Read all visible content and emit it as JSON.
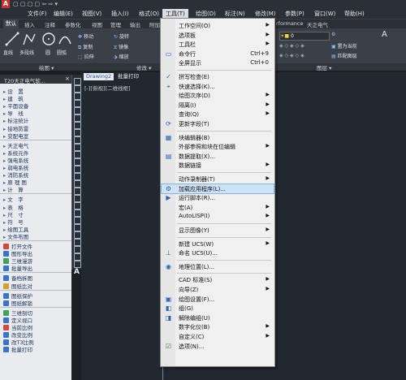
{
  "menubar": {
    "items": [
      "文件(F)",
      "编辑(E)",
      "视图(V)",
      "插入(I)",
      "格式(O)",
      "工具(T)",
      "绘图(D)",
      "标注(N)",
      "修改(M)",
      "参数(P)",
      "窗口(W)",
      "帮助(H)"
    ]
  },
  "ribbon": {
    "tabs": [
      "默认",
      "插入",
      "注释",
      "参数化",
      "视图",
      "管理",
      "输出",
      "附加"
    ],
    "right_tabs": [
      "rformance",
      "天正电气"
    ],
    "tools": {
      "line": "直线",
      "polyline": "多段线",
      "circle": "圆",
      "arc": "圆弧",
      "move": "移动",
      "rotate": "旋转",
      "copy": "复制",
      "mirror": "镜像",
      "stretch": "拉伸",
      "scale": "缩放",
      "set_current": "置为当前",
      "match_layer": "匹配图层",
      "layer_value": "0"
    },
    "panels": [
      "绘图 ▾",
      "修改 ▾",
      "图层 ▾"
    ]
  },
  "palette": {
    "title": "T20天正电气软...",
    "items": [
      {
        "type": "tri",
        "label": "设　置"
      },
      {
        "type": "tri",
        "label": "建　筑"
      },
      {
        "type": "tri",
        "label": "平面设备"
      },
      {
        "type": "tri",
        "label": "导　线"
      },
      {
        "type": "tri",
        "label": "标注统计"
      },
      {
        "type": "tri",
        "label": "接地防雷"
      },
      {
        "type": "tri",
        "label": "变配电室"
      },
      {
        "type": "sep"
      },
      {
        "type": "tri",
        "label": "天正电气"
      },
      {
        "type": "tri",
        "label": "系统元件"
      },
      {
        "type": "tri",
        "label": "强电系统"
      },
      {
        "type": "tri",
        "label": "弱电系统"
      },
      {
        "type": "tri",
        "label": "消防系统"
      },
      {
        "type": "tri",
        "label": "原 理 图"
      },
      {
        "type": "tri",
        "label": "计　算"
      },
      {
        "type": "sep"
      },
      {
        "type": "tri",
        "label": "文　字"
      },
      {
        "type": "tri",
        "label": "表　格"
      },
      {
        "type": "tri",
        "label": "尺　寸"
      },
      {
        "type": "tri",
        "label": "符　号"
      },
      {
        "type": "tri",
        "label": "绘图工具"
      },
      {
        "type": "tri",
        "label": "文件布图"
      },
      {
        "type": "sep"
      },
      {
        "type": "pic",
        "label": "打开文件",
        "color": "#d24a3a"
      },
      {
        "type": "pic",
        "label": "图形导出",
        "color": "#3a74c9"
      },
      {
        "type": "pic",
        "label": "三维漫游",
        "color": "#3fa45a"
      },
      {
        "type": "pic",
        "label": "批量导出",
        "color": "#3a74c9"
      },
      {
        "type": "sep"
      },
      {
        "type": "pic",
        "label": "备档拆图",
        "color": "#3a74c9"
      },
      {
        "type": "pic",
        "label": "图纸比对",
        "color": "#d4a12b"
      },
      {
        "type": "sep"
      },
      {
        "type": "pic",
        "label": "图纸保护",
        "color": "#3a74c9"
      },
      {
        "type": "pic",
        "label": "图纸解锁",
        "color": "#3a74c9"
      },
      {
        "type": "sep"
      },
      {
        "type": "pic",
        "label": "三维剖切",
        "color": "#3fa45a"
      },
      {
        "type": "pic",
        "label": "定义视口",
        "color": "#3a74c9"
      },
      {
        "type": "pic",
        "label": "当前比例",
        "color": "#d24a3a"
      },
      {
        "type": "pic",
        "label": "改变比例",
        "color": "#3a74c9"
      },
      {
        "type": "pic",
        "label": "改T3比例",
        "color": "#3a74c9"
      },
      {
        "type": "pic",
        "label": "批量打印",
        "color": "#3a74c9"
      }
    ]
  },
  "drawing": {
    "tabs": [
      "Drawing2",
      "批量打印"
    ],
    "view_label": "[-][俯视][二维线框]"
  },
  "tools_menu": {
    "items": [
      {
        "label": "工作空间(O)",
        "arrow": true
      },
      {
        "label": "选项板",
        "arrow": true
      },
      {
        "label": "工具栏",
        "arrow": true
      },
      {
        "label": "命令行",
        "shortcut": "Ctrl+9",
        "icon": "cmd"
      },
      {
        "label": "全屏显示",
        "shortcut": "Ctrl+0"
      },
      {
        "sep": true
      },
      {
        "label": "拼写检查(E)",
        "icon": "spell"
      },
      {
        "label": "快速选择(K)...",
        "icon": "qsel"
      },
      {
        "label": "绘图次序(D)",
        "arrow": true
      },
      {
        "label": "隔离(I)",
        "arrow": true
      },
      {
        "label": "查询(Q)",
        "arrow": true
      },
      {
        "label": "更新字段(T)",
        "icon": "field"
      },
      {
        "sep": true
      },
      {
        "label": "块编辑器(B)",
        "icon": "block"
      },
      {
        "label": "外部参照和块在位编辑",
        "arrow": true
      },
      {
        "label": "数据提取(X)...",
        "icon": "data"
      },
      {
        "label": "数据链接",
        "arrow": true
      },
      {
        "sep": true
      },
      {
        "label": "动作录制器(T)",
        "arrow": true
      },
      {
        "label": "加载应用程序(L)...",
        "icon": "load",
        "highlight": true
      },
      {
        "label": "运行脚本(R)...",
        "icon": "script"
      },
      {
        "label": "宏(A)",
        "arrow": true
      },
      {
        "label": "AutoLISP(I)",
        "arrow": true
      },
      {
        "sep": true
      },
      {
        "label": "显示图像(Y)",
        "arrow": true
      },
      {
        "sep": true
      },
      {
        "label": "新建 UCS(W)",
        "arrow": true
      },
      {
        "label": "命名 UCS(U)...",
        "icon": "ucs"
      },
      {
        "sep": true
      },
      {
        "label": "地理位置(L)...",
        "icon": "geo"
      },
      {
        "sep": true
      },
      {
        "label": "CAD 标准(S)",
        "arrow": true
      },
      {
        "label": "向导(Z)",
        "arrow": true
      },
      {
        "label": "绘图设置(F)...",
        "icon": "dset"
      },
      {
        "label": "组(G)",
        "icon": "group"
      },
      {
        "label": "解除编组(U)",
        "icon": "ungroup"
      },
      {
        "label": "数字化仪(B)",
        "arrow": true
      },
      {
        "label": "自定义(C)",
        "arrow": true
      },
      {
        "label": "选项(N)...",
        "icon": "opts"
      }
    ]
  }
}
